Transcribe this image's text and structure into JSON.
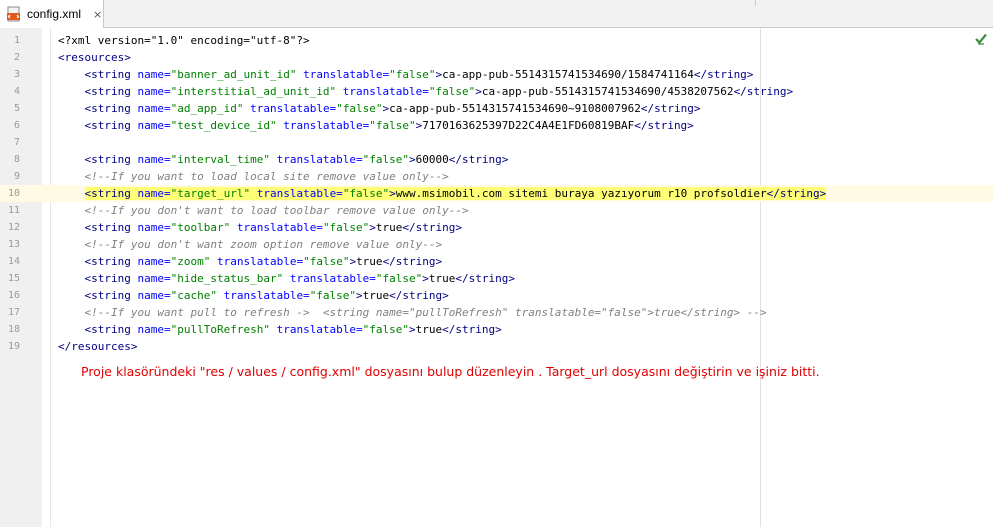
{
  "tab": {
    "title": "config.xml",
    "icon": "xml-file-icon",
    "close": "×"
  },
  "status": {
    "icon": "check-icon",
    "color": "#3c8c3c"
  },
  "editor": {
    "current_line": 10,
    "lines": [
      {
        "n": "1",
        "tokens": [
          [
            "txt",
            "<?xml version=\"1.0\" encoding=\"utf-8\"?>"
          ]
        ]
      },
      {
        "n": "2",
        "tokens": [
          [
            "tag",
            "<resources>"
          ]
        ]
      },
      {
        "n": "3",
        "tokens": [
          [
            "txt",
            "    "
          ],
          [
            "tag",
            "<string "
          ],
          [
            "attr",
            "name="
          ],
          [
            "val",
            "\"banner_ad_unit_id\""
          ],
          [
            "attr",
            " translatable="
          ],
          [
            "val",
            "\"false\""
          ],
          [
            "tag",
            ">"
          ],
          [
            "txt",
            "ca-app-pub-5514315741534690/1584741164"
          ],
          [
            "tag",
            "</string>"
          ]
        ]
      },
      {
        "n": "4",
        "tokens": [
          [
            "txt",
            "    "
          ],
          [
            "tag",
            "<string "
          ],
          [
            "attr",
            "name="
          ],
          [
            "val",
            "\"interstitial_ad_unit_id\""
          ],
          [
            "attr",
            " translatable="
          ],
          [
            "val",
            "\"false\""
          ],
          [
            "tag",
            ">"
          ],
          [
            "txt",
            "ca-app-pub-5514315741534690/4538207562"
          ],
          [
            "tag",
            "</string>"
          ]
        ]
      },
      {
        "n": "5",
        "tokens": [
          [
            "txt",
            "    "
          ],
          [
            "tag",
            "<string "
          ],
          [
            "attr",
            "name="
          ],
          [
            "val",
            "\"ad_app_id\""
          ],
          [
            "attr",
            " translatable="
          ],
          [
            "val",
            "\"false\""
          ],
          [
            "tag",
            ">"
          ],
          [
            "txt",
            "ca-app-pub-5514315741534690~9108007962"
          ],
          [
            "tag",
            "</string>"
          ]
        ]
      },
      {
        "n": "6",
        "tokens": [
          [
            "txt",
            "    "
          ],
          [
            "tag",
            "<string "
          ],
          [
            "attr",
            "name="
          ],
          [
            "val",
            "\"test_device_id\""
          ],
          [
            "attr",
            " translatable="
          ],
          [
            "val",
            "\"false\""
          ],
          [
            "tag",
            ">"
          ],
          [
            "txt",
            "7170163625397D22C4A4E1FD60819BAF"
          ],
          [
            "tag",
            "</string>"
          ]
        ]
      },
      {
        "n": "7",
        "tokens": []
      },
      {
        "n": "8",
        "tokens": [
          [
            "txt",
            "    "
          ],
          [
            "tag",
            "<string "
          ],
          [
            "attr",
            "name="
          ],
          [
            "val",
            "\"interval_time\""
          ],
          [
            "attr",
            " translatable="
          ],
          [
            "val",
            "\"false\""
          ],
          [
            "tag",
            ">"
          ],
          [
            "txt",
            "60000"
          ],
          [
            "tag",
            "</string>"
          ]
        ]
      },
      {
        "n": "9",
        "tokens": [
          [
            "txt",
            "    "
          ],
          [
            "cmt",
            "<!--If you want to load local site remove value only-->"
          ]
        ]
      },
      {
        "n": "10",
        "tokens": [
          [
            "txt",
            "    "
          ],
          [
            "tag",
            "<string "
          ],
          [
            "attr",
            "name="
          ],
          [
            "val",
            "\"target_url\""
          ],
          [
            "attr",
            " translatable="
          ],
          [
            "val",
            "\"false\""
          ],
          [
            "tag",
            ">"
          ],
          [
            "txt",
            "www.msimobil.com sitemi buraya yazıyorum r10 profsoldier"
          ],
          [
            "tag",
            "</string>"
          ]
        ],
        "highlight": true
      },
      {
        "n": "11",
        "tokens": [
          [
            "txt",
            "    "
          ],
          [
            "cmt",
            "<!--If you don't want to load toolbar remove value only-->"
          ]
        ]
      },
      {
        "n": "12",
        "tokens": [
          [
            "txt",
            "    "
          ],
          [
            "tag",
            "<string "
          ],
          [
            "attr",
            "name="
          ],
          [
            "val",
            "\"toolbar\""
          ],
          [
            "attr",
            " translatable="
          ],
          [
            "val",
            "\"false\""
          ],
          [
            "tag",
            ">"
          ],
          [
            "txt",
            "true"
          ],
          [
            "tag",
            "</string>"
          ]
        ]
      },
      {
        "n": "13",
        "tokens": [
          [
            "txt",
            "    "
          ],
          [
            "cmt",
            "<!--If you don't want zoom option remove value only-->"
          ]
        ]
      },
      {
        "n": "14",
        "tokens": [
          [
            "txt",
            "    "
          ],
          [
            "tag",
            "<string "
          ],
          [
            "attr",
            "name="
          ],
          [
            "val",
            "\"zoom\""
          ],
          [
            "attr",
            " translatable="
          ],
          [
            "val",
            "\"false\""
          ],
          [
            "tag",
            ">"
          ],
          [
            "txt",
            "true"
          ],
          [
            "tag",
            "</string>"
          ]
        ]
      },
      {
        "n": "15",
        "tokens": [
          [
            "txt",
            "    "
          ],
          [
            "tag",
            "<string "
          ],
          [
            "attr",
            "name="
          ],
          [
            "val",
            "\"hide_status_bar\""
          ],
          [
            "attr",
            " translatable="
          ],
          [
            "val",
            "\"false\""
          ],
          [
            "tag",
            ">"
          ],
          [
            "txt",
            "true"
          ],
          [
            "tag",
            "</string>"
          ]
        ]
      },
      {
        "n": "16",
        "tokens": [
          [
            "txt",
            "    "
          ],
          [
            "tag",
            "<string "
          ],
          [
            "attr",
            "name="
          ],
          [
            "val",
            "\"cache\""
          ],
          [
            "attr",
            " translatable="
          ],
          [
            "val",
            "\"false\""
          ],
          [
            "tag",
            ">"
          ],
          [
            "txt",
            "true"
          ],
          [
            "tag",
            "</string>"
          ]
        ]
      },
      {
        "n": "17",
        "tokens": [
          [
            "txt",
            "    "
          ],
          [
            "cmt",
            "<!--If you want pull to refresh ->  <string name=\"pullToRefresh\" translatable=\"false\">true</string> -->"
          ]
        ]
      },
      {
        "n": "18",
        "tokens": [
          [
            "txt",
            "    "
          ],
          [
            "tag",
            "<string "
          ],
          [
            "attr",
            "name="
          ],
          [
            "val",
            "\"pullToRefresh\""
          ],
          [
            "attr",
            " translatable="
          ],
          [
            "val",
            "\"false\""
          ],
          [
            "tag",
            ">"
          ],
          [
            "txt",
            "true"
          ],
          [
            "tag",
            "</string>"
          ]
        ]
      },
      {
        "n": "19",
        "tokens": [
          [
            "tag",
            "</resources>"
          ]
        ]
      }
    ]
  },
  "note": "Proje klasöründeki \"res / values / config.xml\" dosyasını bulup düzenleyin . Target_url dosyasını değiştirin ve işiniz bitti."
}
